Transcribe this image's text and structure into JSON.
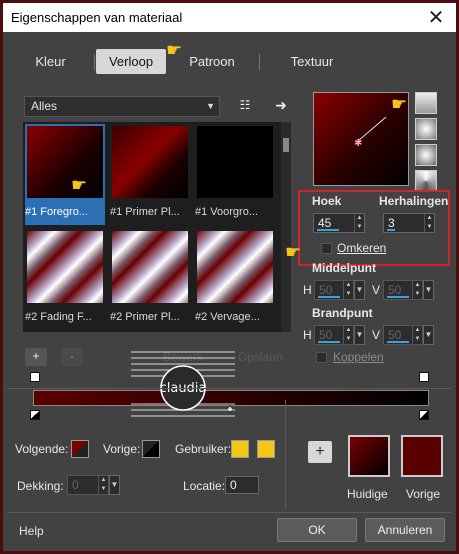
{
  "window": {
    "title": "Eigenschappen van materiaal",
    "close_glyph": "✕"
  },
  "tabs": [
    {
      "label": "Kleur",
      "active": false
    },
    {
      "label": "Verloop",
      "active": true
    },
    {
      "label": "Patroon",
      "active": false
    },
    {
      "label": "Textuur",
      "active": false
    }
  ],
  "category_dropdown": {
    "value": "Alles"
  },
  "gallery": {
    "items": [
      {
        "label": "#1 Foregro...",
        "selected": true
      },
      {
        "label": "#1 Primer Pl...",
        "selected": false
      },
      {
        "label": "#1 Voorgro...",
        "selected": false
      },
      {
        "label": "#2 Fading F...",
        "selected": false
      },
      {
        "label": "#2 Primer Pl...",
        "selected": false
      },
      {
        "label": "#2 Vervage...",
        "selected": false
      }
    ]
  },
  "gradient_settings": {
    "angle_label": "Hoek",
    "angle_value": "45",
    "repeats_label": "Herhalingen",
    "repeats_value": "3",
    "invert_label": "Omkeren",
    "midpoint_label": "Middelpunt",
    "focal_label": "Brandpunt",
    "h_label": "H",
    "v_label": "V",
    "mid_h": "50",
    "mid_v": "50",
    "focal_h": "50",
    "focal_v": "50",
    "link_label": "Koppelen"
  },
  "gradient_editor": {
    "add": "+",
    "remove": "-",
    "plus_button": "+",
    "dimmed_left": "Bewerk",
    "dimmed_right": "Opslaan"
  },
  "stops": {
    "next_label": "Volgende:",
    "prev_label": "Vorige:",
    "user_label": "Gebruiker:",
    "opacity_label": "Dekking:",
    "opacity_value": "0",
    "location_label": "Locatie:",
    "location_value": "0"
  },
  "swatches": {
    "current_label": "Huidige",
    "previous_label": "Vorige",
    "current_color": "#7a0000",
    "previous_color": "#5a0000",
    "user_color": "#f5c518"
  },
  "footer": {
    "help": "Help",
    "ok": "OK",
    "cancel": "Annuleren"
  },
  "watermark": {
    "text": "claudia"
  },
  "colors": {
    "accent_blue": "#2d6fb5",
    "highlight_red": "#d2232a",
    "bg": "#424242"
  }
}
